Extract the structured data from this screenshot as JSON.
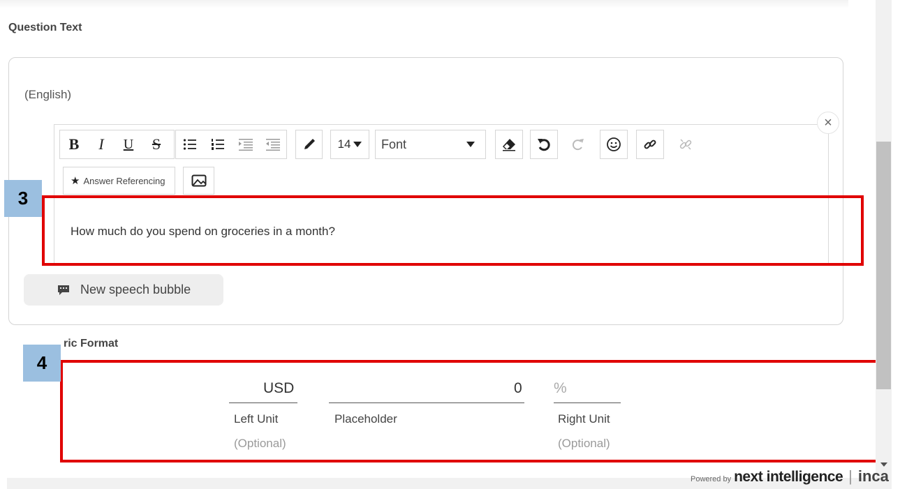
{
  "question_section": {
    "label": "Question Text",
    "language": "(English)",
    "close_icon": "×",
    "toolbar": {
      "bold": "B",
      "italic": "I",
      "underline": "U",
      "strikethrough": "S",
      "font_size": "14",
      "font_select": "Font",
      "answer_referencing": "Answer Referencing"
    },
    "question_text": "How much do you spend on groceries in a month?",
    "speech_bubble_button": "New speech bubble"
  },
  "numeric_section": {
    "label": "ric Format",
    "left_unit": {
      "value": "USD",
      "label": "Left Unit",
      "hint": "(Optional)"
    },
    "placeholder": {
      "value": "0",
      "label": "Placeholder"
    },
    "right_unit": {
      "value": "%",
      "label": "Right Unit",
      "hint": "(Optional)"
    }
  },
  "annotations": {
    "badge_3": "3",
    "badge_4": "4",
    "highlight_color": "#e00000",
    "badge_color": "#9bbfe0"
  },
  "footer": {
    "powered_by": "Powered by",
    "brand": "next intelligence",
    "separator": "|",
    "product": "inca"
  },
  "icons": [
    "close-icon",
    "bullet-list-icon",
    "numbered-list-icon",
    "indent-icon",
    "outdent-icon",
    "pen-icon",
    "caret-down-icon",
    "eraser-icon",
    "undo-icon",
    "redo-icon",
    "emoji-icon",
    "link-icon",
    "unlink-icon",
    "star-icon",
    "image-icon",
    "speech-bubble-icon"
  ]
}
